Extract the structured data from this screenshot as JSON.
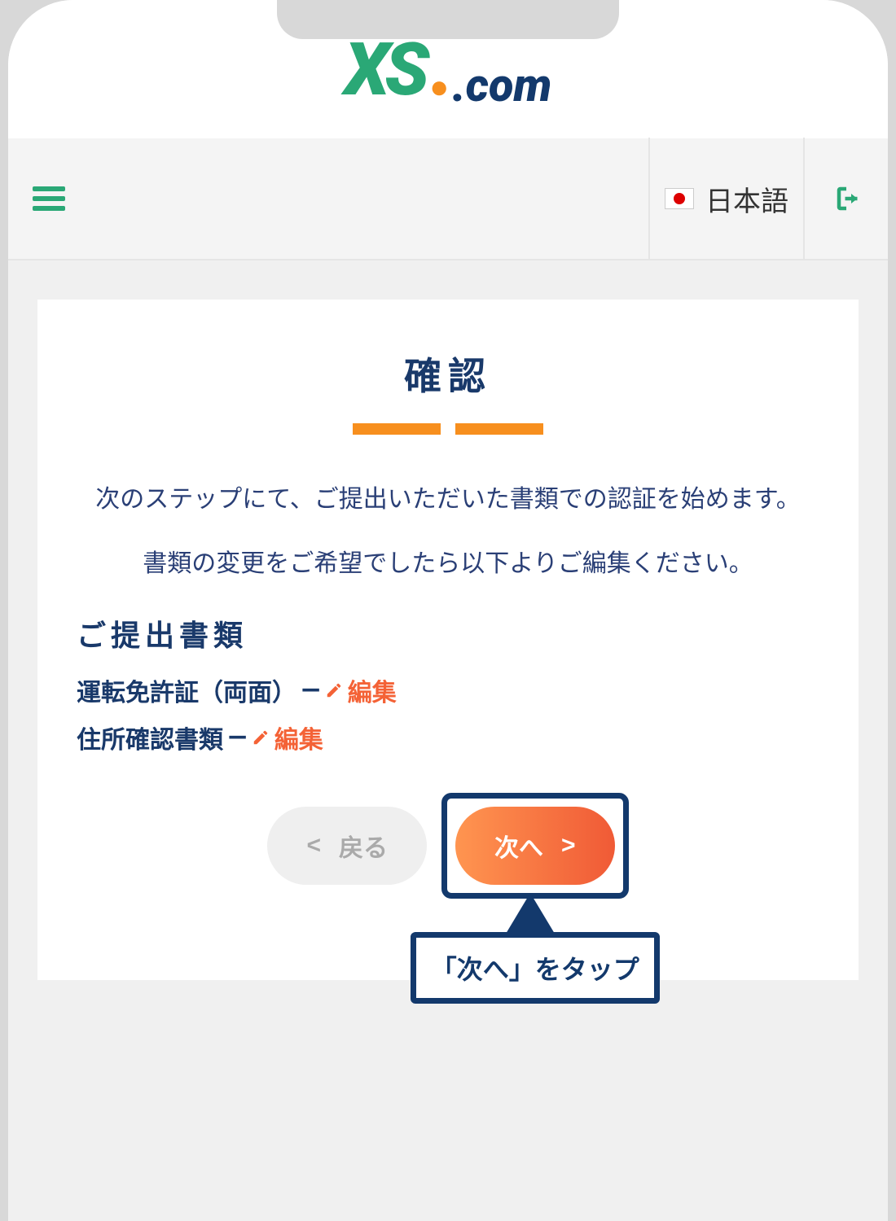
{
  "brand": {
    "xs": "XS",
    "suffix": ".com"
  },
  "nav": {
    "language_label": "日本語"
  },
  "card": {
    "title": "確認",
    "paragraph1": "次のステップにて、ご提出いただいた書類での認証を始めます。",
    "paragraph2": "書類の変更をご希望でしたら以下よりご編集ください。",
    "docs_title": "ご提出書類",
    "documents": [
      {
        "label": "運転免許証（両面）",
        "sep": "—",
        "edit": "編集"
      },
      {
        "label": "住所確認書類",
        "sep": "—",
        "edit": "編集"
      }
    ],
    "back_label": "戻る",
    "next_label": "次へ"
  },
  "callout": {
    "text": "「次へ」をタップ"
  }
}
